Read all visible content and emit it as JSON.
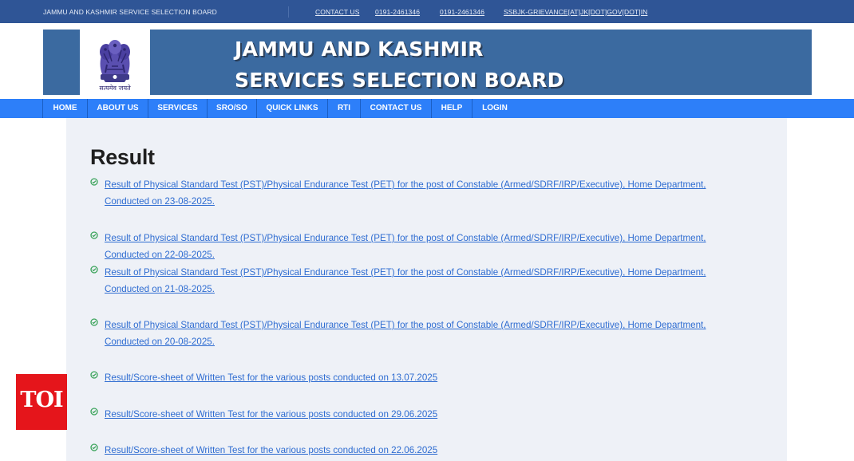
{
  "topbar": {
    "org_name": "JAMMU AND KASHMIR SERVICE SELECTION BOARD",
    "links": [
      "CONTACT US",
      "0191-2461346",
      "0191-2461346",
      "SSBJK-GRIEVANCE[AT]JK[DOT]GOV[DOT]IN"
    ]
  },
  "banner": {
    "title_line1": "JAMMU AND KASHMIR",
    "title_line2": "SERVICES SELECTION BOARD",
    "emblem_caption": "सत्यमेव जयते"
  },
  "nav": {
    "items": [
      "HOME",
      "ABOUT US",
      "SERVICES",
      "SRO/SO",
      "QUICK LINKS",
      "RTI",
      "CONTACT US",
      "HELP",
      "LOGIN"
    ]
  },
  "main": {
    "title": "Result",
    "results": [
      {
        "line1": "Result of Physical Standard Test (PST)/Physical Endurance Test (PET) for the post of Constable (Armed/SDRF/IRP/Executive), Home Department,",
        "line2": "Conducted on 23-08-2025."
      },
      {
        "line1": "Result of Physical Standard Test (PST)/Physical Endurance Test (PET) for the post of Constable (Armed/SDRF/IRP/Executive), Home Department,",
        "line2": "Conducted on 22-08-2025."
      },
      {
        "line1": "Result of Physical Standard Test (PST)/Physical Endurance Test (PET) for the post of Constable (Armed/SDRF/IRP/Executive), Home Department,",
        "line2": "Conducted on 21-08-2025."
      },
      {
        "line1": "Result of Physical Standard Test (PST)/Physical Endurance Test (PET) for the post of Constable (Armed/SDRF/IRP/Executive), Home Department,",
        "line2": "Conducted on 20-08-2025."
      },
      {
        "line1": "Result/Score-sheet of Written Test for the various posts conducted on 13.07.2025"
      },
      {
        "line1": "Result/Score-sheet of Written Test for the various posts conducted on 29.06.2025"
      },
      {
        "line1": "Result/Score-sheet of Written Test for the various posts conducted on 22.06.2025"
      }
    ]
  },
  "watermark": {
    "label": "TOI"
  },
  "colors": {
    "topbar": "#2f5596",
    "banner": "#3b6aa0",
    "nav": "#2d7ff9",
    "link": "#2e6cd1",
    "check": "#3aa35a",
    "content_bg": "#eef1f7",
    "watermark": "#e5151b"
  },
  "icons": {
    "result_bullet": "check-circle-icon",
    "emblem": "national-emblem-icon"
  }
}
